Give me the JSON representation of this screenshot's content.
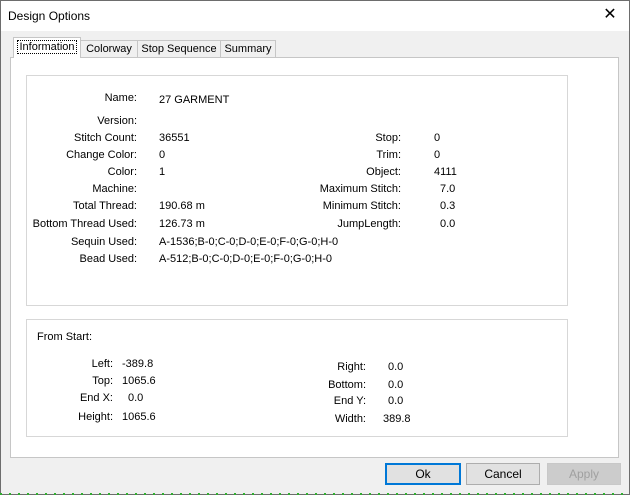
{
  "window": {
    "title": "Design Options",
    "close_glyph": "✕"
  },
  "tabs": [
    {
      "label": "Information",
      "active": true
    },
    {
      "label": "Colorway"
    },
    {
      "label": "Stop Sequence"
    },
    {
      "label": "Summary"
    }
  ],
  "info": {
    "name_label": "Name:",
    "name_value": "27 GARMENT",
    "version_label": "Version:",
    "stitch_count_label": "Stitch Count:",
    "stitch_count_value": "36551",
    "change_color_label": "Change Color:",
    "change_color_value": "0",
    "color_label": "Color:",
    "color_value": "1",
    "machine_label": "Machine:",
    "total_thread_label": "Total Thread:",
    "total_thread_value": "190.68 m",
    "bottom_thread_label": "Bottom Thread Used:",
    "bottom_thread_value": "126.73 m",
    "sequin_label": "Sequin Used:",
    "sequin_value": "A-1536;B-0;C-0;D-0;E-0;F-0;G-0;H-0",
    "bead_label": "Bead Used:",
    "bead_value": "A-512;B-0;C-0;D-0;E-0;F-0;G-0;H-0",
    "stop_label": "Stop:",
    "stop_value": "0",
    "trim_label": "Trim:",
    "trim_value": "0",
    "object_label": "Object:",
    "object_value": "4111",
    "max_stitch_label": "Maximum Stitch:",
    "max_stitch_value": "7.0",
    "min_stitch_label": "Minimum Stitch:",
    "min_stitch_value": "0.3",
    "jump_length_label": "JumpLength:",
    "jump_length_value": "0.0"
  },
  "from_start": {
    "heading": "From Start:",
    "left_label": "Left:",
    "left_value": "-389.8",
    "top_label": "Top:",
    "top_value": "1065.6",
    "endx_label": "End X:",
    "endx_value": "0.0",
    "height_label": "Height:",
    "height_value": "1065.6",
    "right_label": "Right:",
    "right_value": "0.0",
    "bottom_label": "Bottom:",
    "bottom_value": "0.0",
    "endy_label": "End Y:",
    "endy_value": "0.0",
    "width_label": "Width:",
    "width_value": "389.8"
  },
  "buttons": {
    "ok": "Ok",
    "cancel": "Cancel",
    "apply": "Apply"
  }
}
